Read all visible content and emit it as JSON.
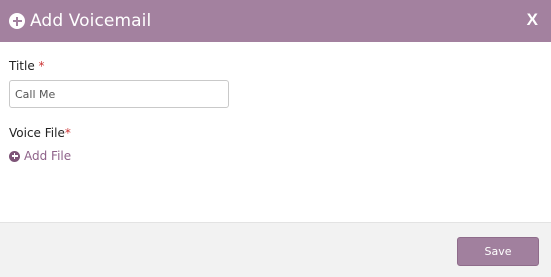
{
  "dialog": {
    "title": "Add Voicemail",
    "close_label": "X",
    "header_icon": "plus-circle-icon"
  },
  "form": {
    "title_label": "Title",
    "title_required_marker": "*",
    "title_value": "Call Me",
    "voice_file_label": "Voice File",
    "voice_file_required_marker": "*",
    "add_file_label": "Add File",
    "add_file_icon": "plus-circle-icon"
  },
  "footer": {
    "save_label": "Save"
  },
  "colors": {
    "header_bg": "#a3819f",
    "accent": "#8e6289",
    "required": "#cc3333",
    "footer_bg": "#f2f2f2"
  }
}
